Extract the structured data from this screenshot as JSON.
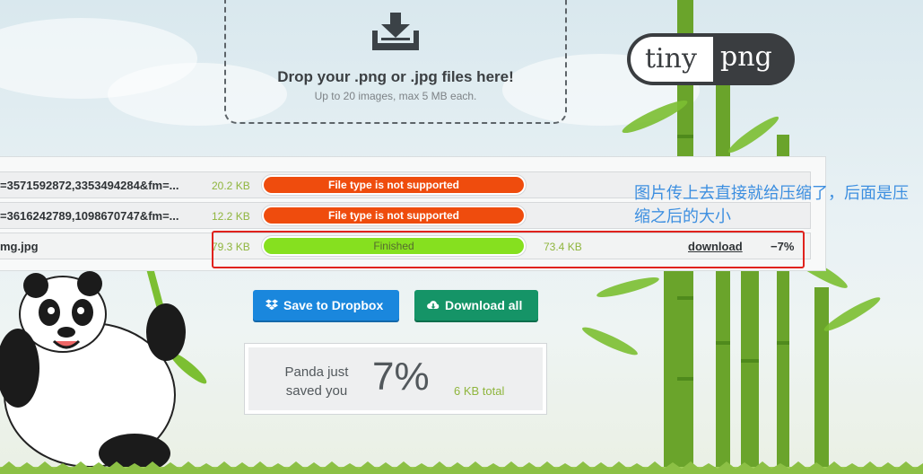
{
  "dropzone": {
    "title": "Drop your .png or .jpg files here!",
    "subtitle": "Up to 20 images, max 5 MB each.",
    "icon": "download-tray-icon"
  },
  "logo": {
    "part1": "tiny",
    "part2": "png"
  },
  "files": [
    {
      "name": "=3571592872,3353494284&fm=...",
      "size": "20.2 KB",
      "status": "File type is not supported",
      "state": "error"
    },
    {
      "name": "=3616242789,1098670747&fm=...",
      "size": "12.2 KB",
      "status": "File type is not supported",
      "state": "error"
    },
    {
      "name": "mg.jpg",
      "size": "79.3 KB",
      "status": "Finished",
      "state": "finished",
      "output_size": "73.4 KB",
      "download_label": "download",
      "savings": "−7%"
    }
  ],
  "annotation": {
    "text": "图片传上去直接就给压缩了，后面是压缩之后的大小"
  },
  "actions": {
    "dropbox_label": "Save to Dropbox",
    "download_all_label": "Download all"
  },
  "summary": {
    "label": "Panda just saved you",
    "percent": "7%",
    "total": "6 KB total"
  },
  "colors": {
    "error": "#ef4c0d",
    "success": "#86e01f",
    "dropbox": "#1a87dd",
    "download": "#159467",
    "accent_green": "#8fb53d",
    "annotation": "#3d8fe0",
    "highlight": "#e0221d"
  }
}
